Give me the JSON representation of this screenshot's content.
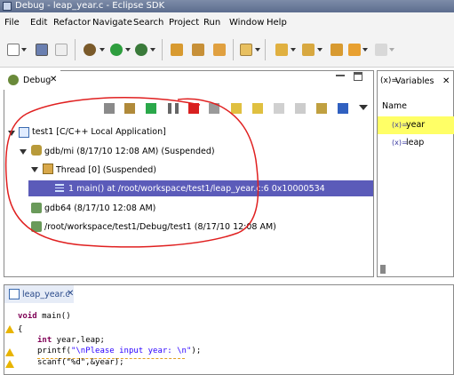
{
  "window": {
    "title": "Debug - leap_year.c - Eclipse SDK"
  },
  "menu": [
    "File",
    "Edit",
    "Refactor",
    "Navigate",
    "Search",
    "Project",
    "Run",
    "Window",
    "Help"
  ],
  "debug_view": {
    "tab_label": "Debug",
    "tree": [
      {
        "label": "test1 [C/C++ Local Application]",
        "icon": "c-app-icon"
      },
      {
        "label": "gdb/mi (8/17/10 12:08 AM) (Suspended)",
        "icon": "debugger-icon"
      },
      {
        "label": "Thread [0] (Suspended)",
        "icon": "thread-icon"
      },
      {
        "label": "1 main() at /root/workspace/test1/leap_year.c:6 0x10000534",
        "icon": "stack-frame-icon",
        "selected": true
      },
      {
        "label": "gdb64 (8/17/10 12:08 AM)",
        "icon": "process-icon"
      },
      {
        "label": "/root/workspace/test1/Debug/test1 (8/17/10 12:08 AM)",
        "icon": "process-icon"
      }
    ]
  },
  "variables_view": {
    "tab_label": "Variables",
    "column_header": "Name",
    "items": [
      {
        "name": "year",
        "highlighted": true
      },
      {
        "name": "leap",
        "highlighted": false
      }
    ]
  },
  "editor": {
    "tab_label": "leap_year.c",
    "lines": [
      {
        "kw": "void",
        "rest": " main()"
      },
      {
        "kw": "",
        "rest": "{"
      },
      {
        "kw": "int",
        "rest": " year,leap;"
      },
      {
        "pre": "printf(",
        "str": "\"\\nPlease input year: \\n\"",
        "post": ");"
      },
      {
        "kw": "",
        "rest": "scanf(\"%d\",&year);"
      }
    ]
  },
  "colors": {
    "selection": "#5b5bb9",
    "highlight": "#ffff66",
    "annotation": "#e02020"
  }
}
